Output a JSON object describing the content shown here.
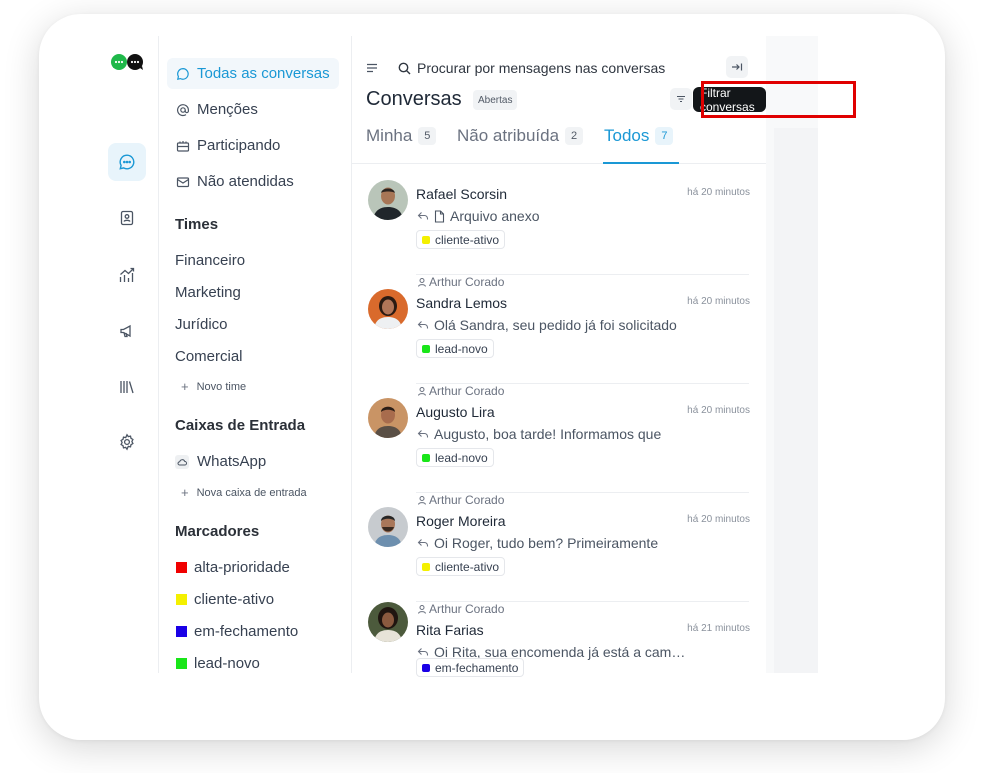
{
  "sidebar": {
    "nav": [
      "Todas as conversas",
      "Menções",
      "Participando",
      "Não atendidas"
    ],
    "teams_title": "Times",
    "teams": [
      "Financeiro",
      "Marketing",
      "Jurídico",
      "Comercial"
    ],
    "new_team": "Novo time",
    "inboxes_title": "Caixas de Entrada",
    "inbox": "WhatsApp",
    "new_inbox": "Nova caixa de entrada",
    "labels_title": "Marcadores",
    "labels": [
      {
        "name": "alta-prioridade",
        "color": "#f00000"
      },
      {
        "name": "cliente-ativo",
        "color": "#f4f000"
      },
      {
        "name": "em-fechamento",
        "color": "#1a00e6"
      },
      {
        "name": "lead-novo",
        "color": "#19e619"
      }
    ]
  },
  "panel": {
    "search_placeholder": "Procurar por mensagens nas conversas",
    "title": "Conversas",
    "status": "Abertas",
    "filter_tooltip": "Filtrar conversas",
    "tabs": [
      {
        "label": "Minha",
        "count": "5"
      },
      {
        "label": "Não atribuída",
        "count": "2"
      },
      {
        "label": "Todos",
        "count": "7"
      }
    ]
  },
  "conversations": [
    {
      "name": "Rafael Scorsin",
      "assignee": "",
      "time": "há 20 minutos",
      "message": "Arquivo anexo",
      "tag": "cliente-ativo",
      "tag_color": "#f4f000"
    },
    {
      "name": "Sandra Lemos",
      "assignee": "Arthur Corado",
      "time": "há 20 minutos",
      "message": "Olá Sandra, seu pedido já foi solicitado",
      "tag": "lead-novo",
      "tag_color": "#19e619"
    },
    {
      "name": "Augusto Lira",
      "assignee": "Arthur Corado",
      "time": "há 20 minutos",
      "message": "Augusto, boa tarde! Informamos que",
      "tag": "lead-novo",
      "tag_color": "#19e619"
    },
    {
      "name": "Roger Moreira",
      "assignee": "Arthur Corado",
      "time": "há 20 minutos",
      "message": "Oi Roger, tudo bem? Primeiramente",
      "tag": "cliente-ativo",
      "tag_color": "#f4f000"
    },
    {
      "name": "Rita Farias",
      "assignee": "Arthur Corado",
      "time": "há 21 minutos",
      "message": "Oi Rita, sua encomenda já está a caminho",
      "tag": "em-fechamento",
      "tag_color": "#1a00e6"
    }
  ]
}
